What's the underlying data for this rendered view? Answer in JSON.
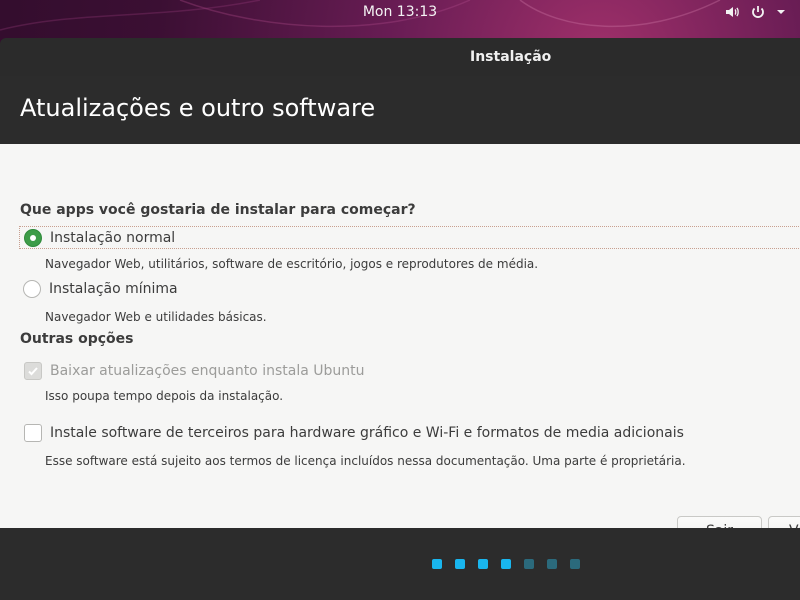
{
  "topbar": {
    "clock": "Mon 13:13"
  },
  "window": {
    "title": "Instalação",
    "heading": "Atualizações e outro software"
  },
  "content": {
    "question": "Que apps você gostaria de instalar para começar?",
    "normal_label": "Instalação normal",
    "normal_desc": "Navegador Web, utilitários, software de escritório, jogos e reprodutores de média.",
    "minimal_label": "Instalação mínima",
    "minimal_desc": "Navegador Web e utilidades básicas.",
    "other_title": "Outras opções",
    "updates_label": "Baixar atualizações enquanto instala Ubuntu",
    "updates_desc": "Isso poupa tempo depois da instalação.",
    "thirdparty_label": "Instale software de terceiros para hardware gráfico e Wi-Fi e formatos de media adicionais",
    "thirdparty_desc": "Esse software está sujeito aos termos de licença incluídos nessa documentação. Uma parte é proprietária."
  },
  "buttons": {
    "quit": "Sair",
    "back": "Ve"
  },
  "progress": {
    "total_steps": 7,
    "completed_steps": 4
  },
  "colors": {
    "accent_green": "#3d9c48",
    "dot_active": "#19b6ee",
    "dot_inactive": "#2b6a7c"
  }
}
